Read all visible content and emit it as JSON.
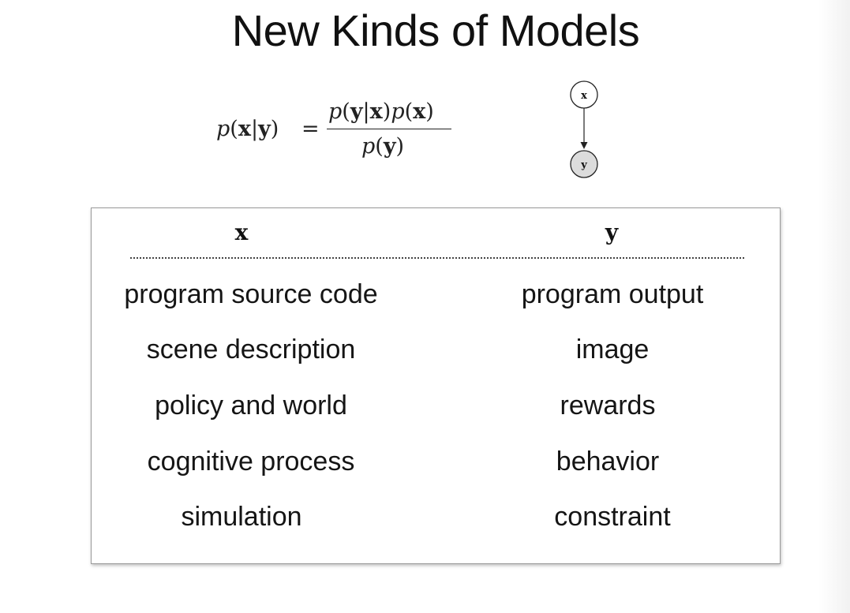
{
  "slide": {
    "title": "New Kinds of Models"
  },
  "formula": {
    "lhs": "p(x|y)",
    "equals": "=",
    "numerator": "p(y|x)p(x)",
    "denominator": "p(y)"
  },
  "graphical_model": {
    "parent_node_label": "x",
    "child_node_label": "y",
    "child_fill": "#dcdcdc",
    "parent_fill": "#ffffff"
  },
  "table": {
    "headers": {
      "x": "x",
      "y": "y"
    },
    "rows": [
      {
        "x": "program source code",
        "y": "program output"
      },
      {
        "x": "scene description",
        "y": "image"
      },
      {
        "x": "policy and world",
        "y": "rewards"
      },
      {
        "x": "cognitive process",
        "y": "behavior"
      },
      {
        "x": "simulation",
        "y": "constraint"
      }
    ]
  }
}
